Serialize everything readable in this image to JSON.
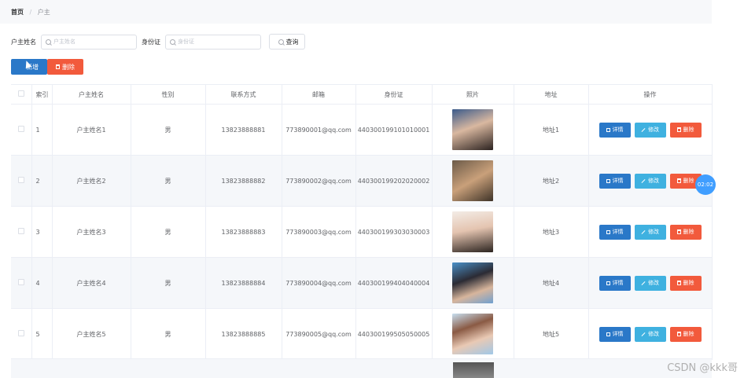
{
  "breadcrumb": {
    "home": "首页",
    "separator": "/",
    "current": "户主"
  },
  "search": {
    "name_label": "户主姓名",
    "name_placeholder": "户主姓名",
    "id_label": "身份证",
    "id_placeholder": "身份证",
    "query_label": "查询"
  },
  "actions": {
    "add_label": "新增",
    "delete_label": "删除"
  },
  "table": {
    "headers": [
      "索引",
      "户主姓名",
      "性别",
      "联系方式",
      "邮箱",
      "身份证",
      "照片",
      "地址",
      "操作"
    ],
    "rows": [
      {
        "index": "1",
        "name": "户主姓名1",
        "gender": "男",
        "phone": "13823888881",
        "email": "773890001@qq.com",
        "idcard": "440300199101010001",
        "address": "地址1"
      },
      {
        "index": "2",
        "name": "户主姓名2",
        "gender": "男",
        "phone": "13823888882",
        "email": "773890002@qq.com",
        "idcard": "440300199202020002",
        "address": "地址2"
      },
      {
        "index": "3",
        "name": "户主姓名3",
        "gender": "男",
        "phone": "13823888883",
        "email": "773890003@qq.com",
        "idcard": "440300199303030003",
        "address": "地址3"
      },
      {
        "index": "4",
        "name": "户主姓名4",
        "gender": "男",
        "phone": "13823888884",
        "email": "773890004@qq.com",
        "idcard": "440300199404040004",
        "address": "地址4"
      },
      {
        "index": "5",
        "name": "户主姓名5",
        "gender": "男",
        "phone": "13823888885",
        "email": "773890005@qq.com",
        "idcard": "440300199505050005",
        "address": "地址5"
      }
    ],
    "row_buttons": {
      "detail": "详情",
      "edit": "修改",
      "delete": "删除"
    }
  },
  "badge_text": "02:02",
  "watermark": "CSDN @kkk哥",
  "colors": {
    "primary": "#2a78c8",
    "info": "#3fb1e0",
    "danger": "#f25a3c"
  }
}
